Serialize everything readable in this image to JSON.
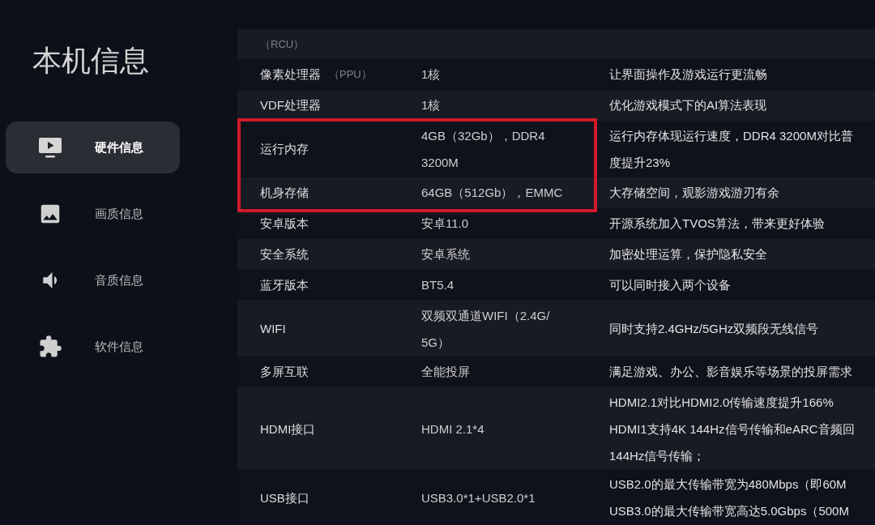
{
  "sidebar": {
    "title": "本机信息",
    "items": [
      {
        "label": "硬件信息",
        "selected": true
      },
      {
        "label": "画质信息",
        "selected": false
      },
      {
        "label": "音质信息",
        "selected": false
      },
      {
        "label": "软件信息",
        "selected": false
      }
    ]
  },
  "table": {
    "rows": [
      {
        "label_note": "（RCU）",
        "highlighted": false
      },
      {
        "label": "像素处理器",
        "label_note": "（PPU）",
        "value": [
          "1核"
        ],
        "description": [
          "让界面操作及游戏运行更流畅"
        ],
        "highlighted": false
      },
      {
        "label": "VDF处理器",
        "value": [
          "1核"
        ],
        "description": [
          "优化游戏模式下的AI算法表现"
        ],
        "highlighted": false
      },
      {
        "label": "运行内存",
        "value": [
          "4GB（32Gb），DDR4",
          "3200M"
        ],
        "description": [
          "运行内存体现运行速度，DDR4 3200M对比普",
          "度提升23%"
        ],
        "highlighted": true
      },
      {
        "label": "机身存储",
        "value": [
          "64GB（512Gb），EMMC"
        ],
        "description": [
          "大存储空间，观影游戏游刃有余"
        ],
        "highlighted": true
      },
      {
        "label": "安卓版本",
        "value": [
          "安卓11.0"
        ],
        "description": [
          "开源系统加入TVOS算法，带来更好体验"
        ],
        "highlighted": false
      },
      {
        "label": "安全系统",
        "value": [
          "安卓系统"
        ],
        "description": [
          "加密处理运算，保护隐私安全"
        ],
        "highlighted": false
      },
      {
        "label": "蓝牙版本",
        "value": [
          "BT5.4"
        ],
        "description": [
          "可以同时接入两个设备"
        ],
        "highlighted": false
      },
      {
        "label": "WIFI",
        "value": [
          "双频双通道WIFI（2.4G/",
          "5G）"
        ],
        "description": [
          "同时支持2.4GHz/5GHz双频段无线信号"
        ],
        "highlighted": false
      },
      {
        "label": "多屏互联",
        "value": [
          "全能投屏"
        ],
        "description": [
          "满足游戏、办公、影音娱乐等场景的投屏需求"
        ],
        "highlighted": false
      },
      {
        "label": "HDMI接口",
        "value": [
          "HDMI 2.1*4"
        ],
        "description": [
          "HDMI2.1对比HDMI2.0传输速度提升166%",
          "HDMI1支持4K 144Hz信号传输和eARC音频回",
          "144Hz信号传输；"
        ],
        "highlighted": false
      },
      {
        "label": "USB接口",
        "value": [
          "USB3.0*1+USB2.0*1"
        ],
        "description": [
          "USB2.0的最大传输带宽为480Mbps（即60M",
          "USB3.0的最大传输带宽高达5.0Gbps（500M"
        ],
        "highlighted": false
      }
    ]
  }
}
